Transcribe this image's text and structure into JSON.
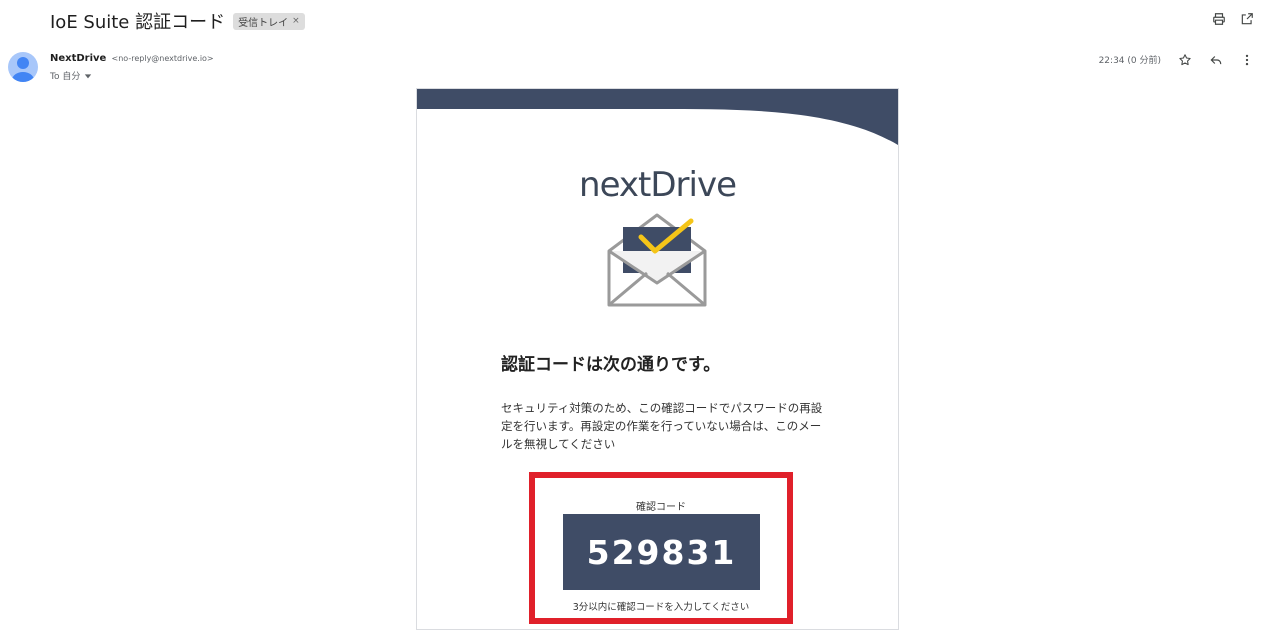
{
  "email": {
    "subject": "IoE Suite 認証コード",
    "label": "受信トレイ",
    "label_remove": "×",
    "sender_name": "NextDrive",
    "sender_email": "<no-reply@nextdrive.io>",
    "to_line": "To 自分",
    "time": "22:34 (0 分前)"
  },
  "message": {
    "brand": "nextDrive",
    "heading": "認証コードは次の通りです。",
    "body": "セキュリティ対策のため、この確認コードでパスワードの再設定を行います。再設定の作業を行っていない場合は、このメールを無視してください",
    "code_label": "確認コード",
    "code": "529831",
    "code_note": "3分以内に確認コードを入力してください"
  },
  "icons": {
    "print": "print-icon",
    "open_new": "open-in-new-window-icon",
    "star": "star-icon",
    "reply": "reply-icon",
    "more": "more-vertical-icon",
    "avatar": "user-avatar-icon",
    "dropdown": "chevron-down-icon"
  },
  "colors": {
    "header_navy": "#3f4c66",
    "check_yellow": "#f5c518",
    "highlight_red": "#e0202a",
    "avatar_blue": "#a8c7fa"
  }
}
